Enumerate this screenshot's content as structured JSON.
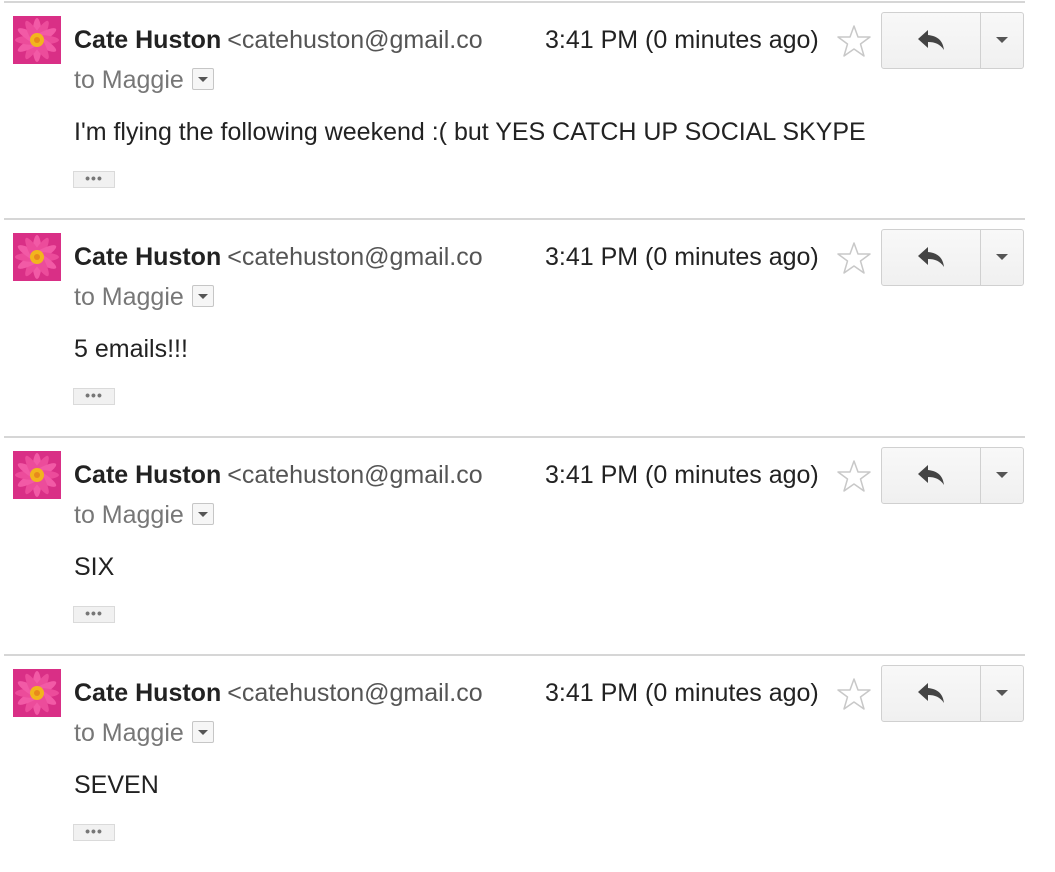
{
  "messages": [
    {
      "sender_name": "Cate Huston",
      "sender_email": "<catehuston@gmail.co",
      "recipient": "to Maggie",
      "time": "3:41 PM (0 minutes ago)",
      "body": "I'm flying the following weekend :( but YES CATCH UP SOCIAL SKYPE",
      "trimmed_content": "•••"
    },
    {
      "sender_name": "Cate Huston",
      "sender_email": "<catehuston@gmail.co",
      "recipient": "to Maggie",
      "time": "3:41 PM (0 minutes ago)",
      "body": "5 emails!!!",
      "trimmed_content": "•••"
    },
    {
      "sender_name": "Cate Huston",
      "sender_email": "<catehuston@gmail.co",
      "recipient": "to Maggie",
      "time": "3:41 PM (0 minutes ago)",
      "body": "SIX",
      "trimmed_content": "•••"
    },
    {
      "sender_name": "Cate Huston",
      "sender_email": "<catehuston@gmail.co",
      "recipient": "to Maggie",
      "time": "3:41 PM (0 minutes ago)",
      "body": "SEVEN",
      "trimmed_content": "•••"
    }
  ],
  "icons": {
    "avatar": "pink-flower-avatar",
    "star": "star-outline-icon",
    "reply": "reply-arrow-icon",
    "more": "chevron-down-icon",
    "recipient_details": "caret-down-icon"
  },
  "colors": {
    "text": "#222222",
    "muted": "#777777",
    "divider": "#d6d6d6",
    "button_border": "#d0d0d0",
    "avatar": "#e03c8c"
  }
}
